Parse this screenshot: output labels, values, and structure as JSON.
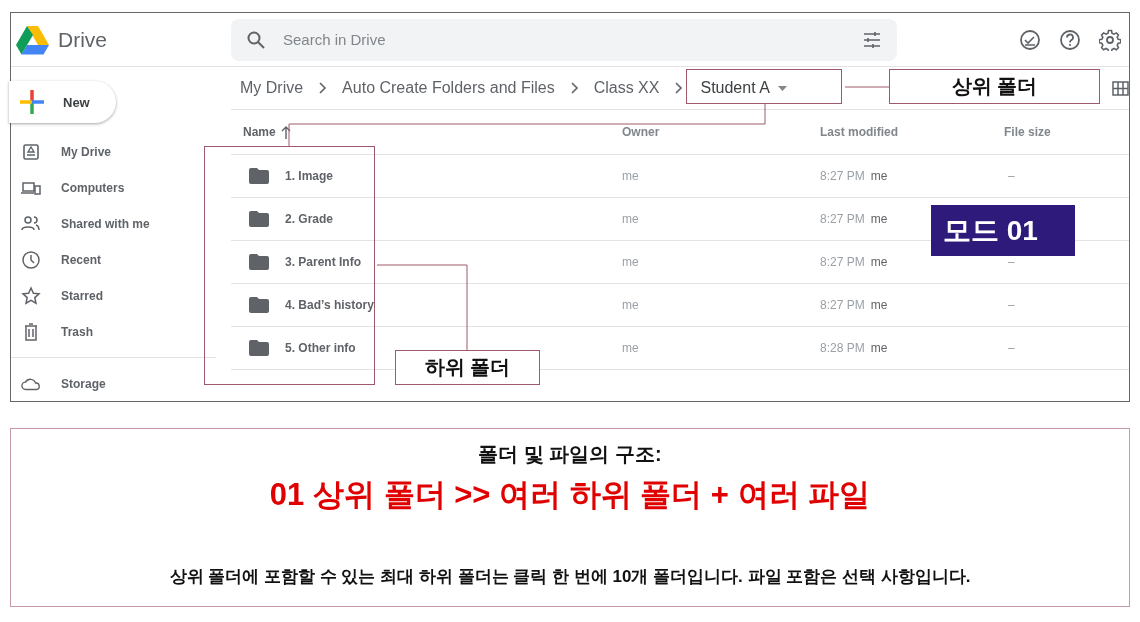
{
  "app": {
    "name": "Drive"
  },
  "search": {
    "placeholder": "Search in Drive"
  },
  "new_button": {
    "label": "New"
  },
  "sidebar": {
    "items": [
      {
        "label": "My Drive",
        "kind": "drive"
      },
      {
        "label": "Computers",
        "kind": "computers"
      },
      {
        "label": "Shared with me",
        "kind": "shared"
      },
      {
        "label": "Recent",
        "kind": "recent"
      },
      {
        "label": "Starred",
        "kind": "starred"
      },
      {
        "label": "Trash",
        "kind": "trash"
      }
    ],
    "storage": {
      "label": "Storage"
    }
  },
  "breadcrumb": [
    "My Drive",
    "Auto Create Folders and Files",
    "Class XX",
    "Student A"
  ],
  "table": {
    "columns": [
      "Name",
      "Owner",
      "Last modified",
      "File size"
    ],
    "rows": [
      {
        "name": "1. Image",
        "owner": "me",
        "modified": "8:27 PM",
        "modified_by": "me",
        "size": "–"
      },
      {
        "name": "2. Grade",
        "owner": "me",
        "modified": "8:27 PM",
        "modified_by": "me"
      },
      {
        "name": "3. Parent Info",
        "owner": "me",
        "modified": "8:27 PM",
        "modified_by": "me",
        "size": "–"
      },
      {
        "name": "4. Bad’s history",
        "owner": "me",
        "modified": "8:27 PM",
        "modified_by": "me",
        "size": "–"
      },
      {
        "name": "5. Other info",
        "owner": "me",
        "modified": "8:28 PM",
        "modified_by": "me",
        "size": "–"
      }
    ]
  },
  "annotations": {
    "parent_label": "상위 폴더",
    "child_label": "하위 폴더",
    "badge": "모드 01"
  },
  "summary": {
    "title": "폴더 및 파일의 구조:",
    "headline": "**01** 상위 폴더 **>>** 여러 하위 폴더 **+** 여러 파일",
    "note": "상위 폴더에 포함할 수 있는 최대 하위 폴더는 클릭 한 번에 10개 폴더입니다. 파일 포함은 선택 사항입니다."
  }
}
